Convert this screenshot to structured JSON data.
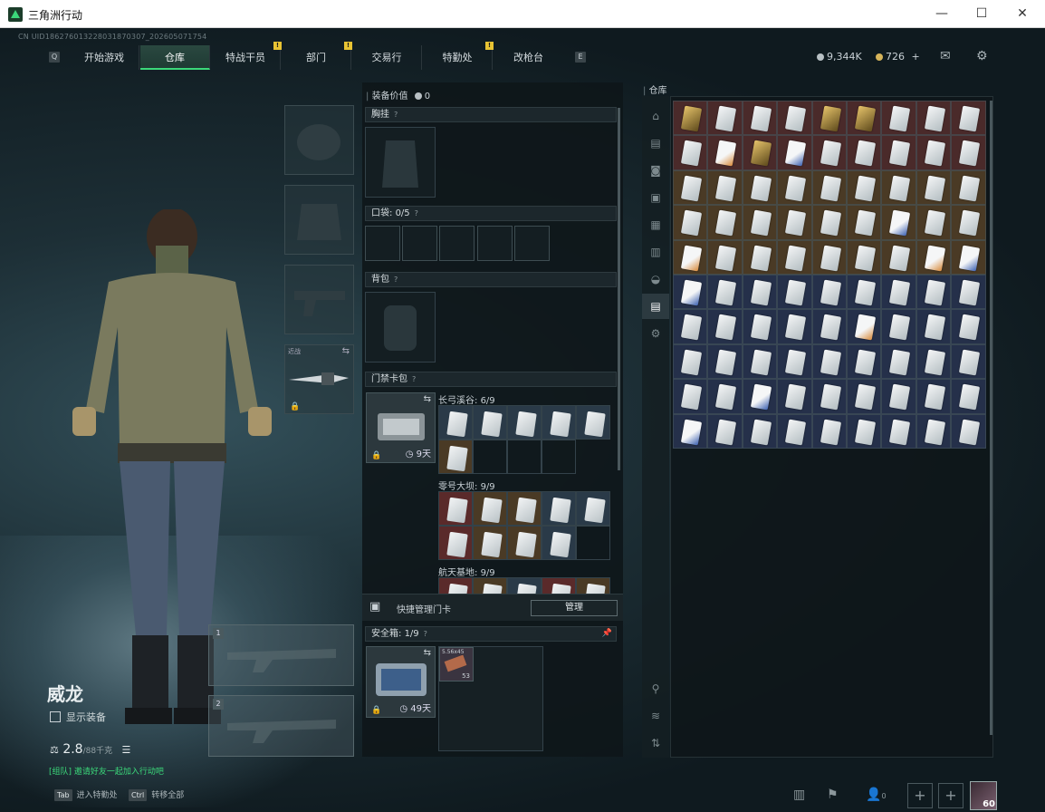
{
  "window": {
    "title": "三角洲行动",
    "minimize": "—",
    "maximize": "☐",
    "close": "✕"
  },
  "uid": "CN UID18627601322803187030​7_202605071754",
  "nav": {
    "left_key": "Q",
    "right_key": "E",
    "tabs": [
      "开始游戏",
      "仓库",
      "特战干员",
      "部门",
      "交易行",
      "特勤处",
      "改枪台"
    ],
    "active_tab": "仓库",
    "alert_mark": "!"
  },
  "currency": {
    "silver": "9,344K",
    "gold": "726",
    "gold_plus": "+"
  },
  "character": {
    "name": "威龙",
    "show_equipment_label": "显示装备",
    "weight": "2.8",
    "weight_max": "/88千克",
    "team_text": "[组队] 邀请好友一起加入行动吧"
  },
  "equipment": {
    "melee_label": "近战",
    "weapon_slots": [
      "1",
      "2"
    ]
  },
  "middle": {
    "equip_value_label": "装备价值",
    "equip_value": "0",
    "chest_rig_label": "胸挂",
    "pockets_label": "口袋:",
    "pockets_value": "0/5",
    "backpack_label": "背包",
    "keycase_label": "门禁卡包",
    "keycase_time": "9天",
    "maps": [
      {
        "name": "长弓溪谷:",
        "count": "6/9"
      },
      {
        "name": "零号大坝:",
        "count": "9/9"
      },
      {
        "name": "航天基地:",
        "count": "9/9"
      }
    ],
    "quick_manage_label": "快捷管理门卡",
    "manage_button": "管理",
    "safebox_label": "安全箱:",
    "safebox_value": "1/9",
    "safebox_time": "49天",
    "safebox_item": "5.56x45",
    "safebox_item_count": "53",
    "help_mark": "?"
  },
  "stash": {
    "label": "仓库",
    "side_tabs": [
      "warehouse-icon",
      "backpack-icon",
      "camera-icon",
      "case-icon",
      "rig-icon",
      "armor-icon",
      "helmet-icon",
      "card-tab",
      "gear-icon",
      "filter-icon",
      "layers-icon",
      "sort-icon"
    ],
    "rows": 10,
    "cols": 9
  },
  "bottom": {
    "hotkey1_key": "Tab",
    "hotkey1_label": "进入特勤处",
    "hotkey2_key": "Ctrl",
    "hotkey2_label": "转移全部",
    "friends_count": "0",
    "level": "60",
    "plus": "+"
  },
  "colors": {
    "accent": "#3bd87a",
    "alert": "#e8c333",
    "row_red": "#5a2a2a",
    "row_brown": "#4a3a25",
    "row_blue": "#25304a"
  }
}
